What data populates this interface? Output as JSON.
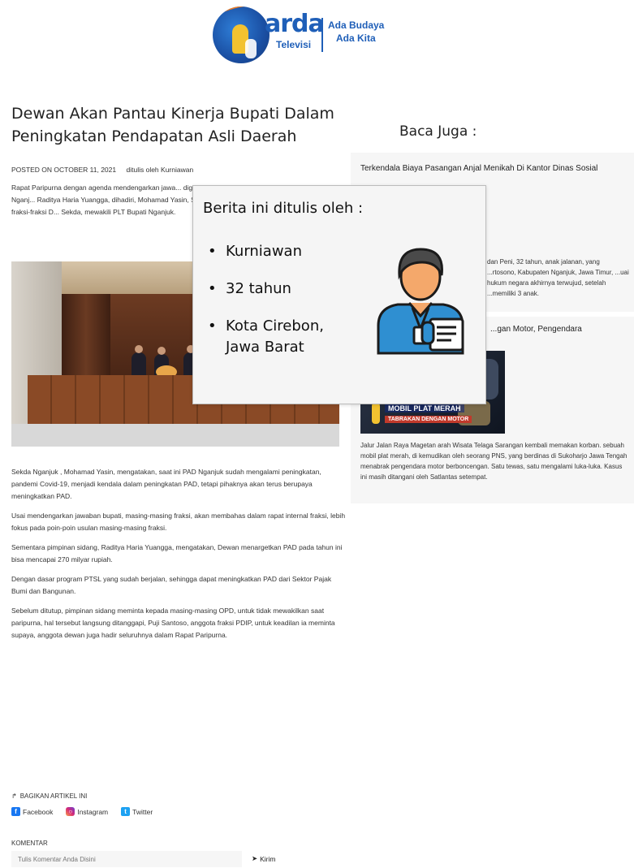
{
  "header": {
    "logo_word": "arda",
    "logo_sub": "Televisi",
    "tagline_1": "Ada Budaya",
    "tagline_2": "Ada Kita"
  },
  "article": {
    "title": "Dewan Akan Pantau Kinerja Bupati Dalam Peningkatan Pendapatan Asli Daerah",
    "posted": "POSTED ON OCTOBER 11, 2021",
    "author_line": "ditulis oleh Kurniawan",
    "intro": "Rapat Paripurna dengan agenda mendengarkan jawa... digelar di ruang Rapat Paripurna Gedung DPRD Nganj... Raditya Haria Yuangga, dihadiri, Mohamad Yasin, Sekd... mewakili. Jawaban bupati atas usulan fraksi-fraksi D... Sekda, mewakili PLT Bupati Nganjuk.",
    "paragraphs": [
      "Sekda Nganjuk , Mohamad Yasin, mengatakan, saat ini PAD Nganjuk sudah mengalami peningkatan, pandemi Covid-19, menjadi kendala dalam peningkatan PAD, tetapi pihaknya akan terus berupaya meningkatkan PAD.",
      "Usai mendengarkan jawaban bupati, masing-masing fraksi, akan membahas dalam rapat internal fraksi, lebih fokus pada poin-poin usulan masing-masing fraksi.",
      "Sementara pimpinan sidang, Raditya Haria Yuangga, mengatakan, Dewan menargetkan PAD pada tahun ini bisa mencapai 270 milyar rupiah.",
      "Dengan dasar program PTSL yang sudah berjalan, sehingga dapat meningkatkan PAD dari Sektor Pajak Bumi dan Bangunan.",
      "Sebelum ditutup, pimpinan sidang meminta kepada masing-masing OPD, untuk tidak mewakilkan saat paripurna, hal tersebut langsung ditanggapi, Puji Santoso, anggota fraksi PDIP, untuk keadilan ia meminta supaya, anggota dewan juga hadir seluruhnya dalam Rapat Paripurna."
    ]
  },
  "sidebar": {
    "title": "Baca Juga :",
    "card1": {
      "title": "Terkendala Biaya Pasangan Anjal Menikah Di Kantor Dinas Sosial",
      "text": "dan Peni, 32 tahun, anak jalanan, yang ...rtosono, Kabupaten Nganjuk, Jawa Timur, ...uai hukum negara akhirnya terwujud, setelah ...memiliki 3 anak."
    },
    "card2": {
      "title": "...gan Motor, Pengendara",
      "thumb_caption_1": "MOBIL PLAT MERAH",
      "thumb_caption_2": "TABRAKAN DENGAN MOTOR",
      "text": "Jalur Jalan Raya Magetan arah Wisata Telaga Sarangan kembali memakan korban. sebuah mobil plat merah, di kemudikan oleh seorang PNS, yang berdinas di Sukoharjo Jawa Tengah menabrak pengendara motor berboncengan. Satu tewas, satu mengalami luka-luka. Kasus ini masih ditangani oleh Satlantas setempat."
    }
  },
  "overlay": {
    "title": "Berita ini ditulis oleh :",
    "items": [
      "Kurniawan",
      "32 tahun",
      "Kota Cirebon, Jawa Barat"
    ],
    "icon": "reporter-icon"
  },
  "share": {
    "heading": "BAGIKAN ARTIKEL INI",
    "facebook": "Facebook",
    "instagram": "Instagram",
    "twitter": "Twitter"
  },
  "comments": {
    "label": "KOMENTAR",
    "placeholder": "Tulis Komentar Anda Disini",
    "send_label": "Kirim"
  }
}
